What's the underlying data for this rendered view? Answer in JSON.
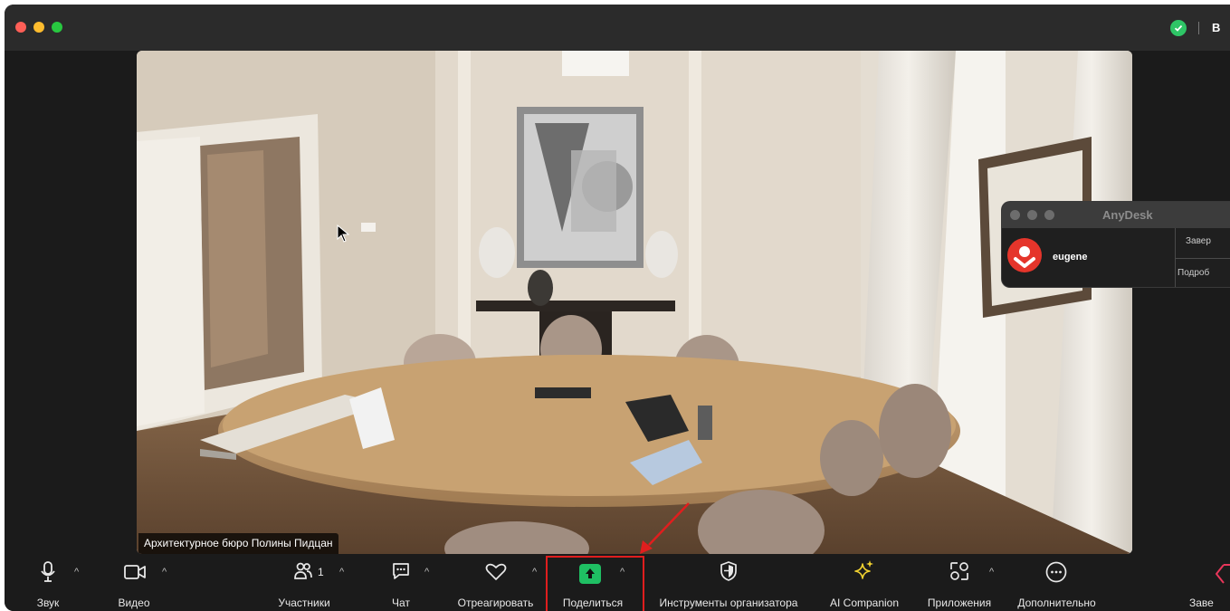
{
  "colors": {
    "window_bg": "#1b1b1b",
    "titlebar_bg": "#2b2b2b",
    "share_green": "#1fbf63",
    "highlight_red": "#e01e1e",
    "ai_star_yellow": "#f2d230",
    "anydesk_red": "#e5352b"
  },
  "titlebar": {
    "right_text": "B"
  },
  "video": {
    "participant_label": "Архитектурное бюро Полины Пидцан"
  },
  "anydesk": {
    "title": "AnyDesk",
    "user_name": "eugene",
    "button_end": "Завер",
    "button_details": "Подроб"
  },
  "toolbar": {
    "audio": {
      "label": "Звук",
      "icon": "microphone-icon"
    },
    "video": {
      "label": "Видео",
      "icon": "camera-icon"
    },
    "participants": {
      "label": "Участники",
      "count": "1",
      "icon": "participants-icon"
    },
    "chat": {
      "label": "Чат",
      "icon": "chat-icon"
    },
    "react": {
      "label": "Отреагировать",
      "icon": "heart-icon"
    },
    "share": {
      "label": "Поделиться",
      "icon": "share-arrow-icon"
    },
    "host_tools": {
      "label": "Инструменты организатора",
      "icon": "shield-icon"
    },
    "ai_companion": {
      "label": "AI Companion",
      "icon": "sparkle-icon"
    },
    "apps": {
      "label": "Приложения",
      "icon": "apps-icon"
    },
    "more": {
      "label": "Дополнительно",
      "icon": "more-icon"
    },
    "end": {
      "label": "Заве"
    }
  }
}
